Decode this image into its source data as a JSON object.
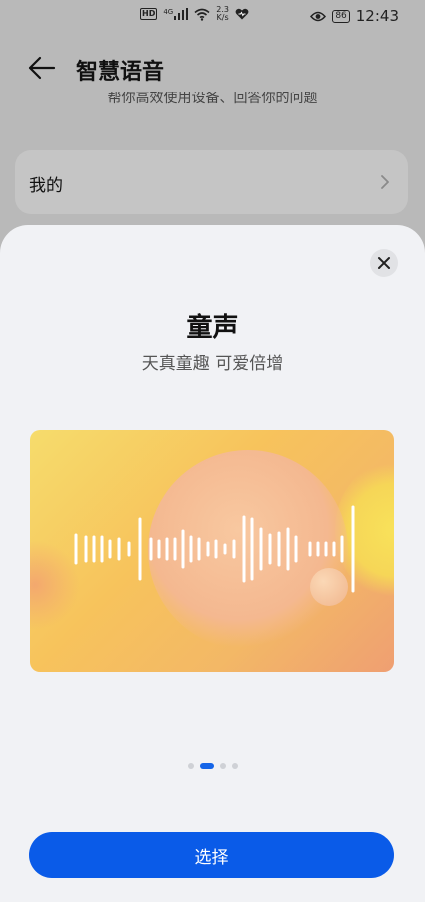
{
  "status_bar": {
    "hd": "HD",
    "signal_type": "4G",
    "net_speed_value": "2.3",
    "net_speed_unit": "K/s",
    "battery": "86",
    "time": "12:43"
  },
  "header": {
    "title": "智慧语音",
    "subtitle": "帮你高效使用设备、回答你的问题"
  },
  "mine_row": {
    "label": "我的"
  },
  "sheet": {
    "voice_name": "童声",
    "voice_desc": "天真童趣 可爱倍增",
    "pager": {
      "total": 4,
      "active_index": 1
    },
    "select_label": "选择"
  },
  "colors": {
    "accent": "#0a5be8",
    "sheet_bg": "#f1f2f5",
    "overlay_bg": "#b9b9b9"
  },
  "icons": {
    "back": "arrow-left-icon",
    "chevron": "chevron-right-icon",
    "close": "close-icon",
    "wifi": "wifi-icon",
    "heart": "heart-icon",
    "eye": "eye-icon"
  }
}
